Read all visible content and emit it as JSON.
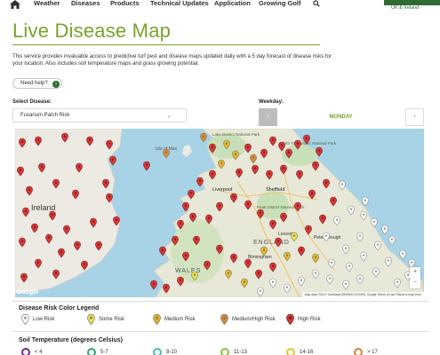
{
  "nav": {
    "items": [
      "Weather",
      "Diseases",
      "Products",
      "Technical Updates",
      "Application",
      "Growing Golf"
    ],
    "brand_sub": "UK & Ireland"
  },
  "page": {
    "title": "Live Disease Map",
    "intro": "This service provides invaluable access to predictive turf pest and disease maps updated daily with a 5 day forecast of disease risks for your location. Also includes soil temperature maps and grass growing potential.",
    "help_label": "Need help?"
  },
  "controls": {
    "disease_label": "Select Disease:",
    "disease_value": "Fusarium Patch Risk",
    "weekday_label": "Weekday:",
    "weekday_value": "MONDAY"
  },
  "map": {
    "places": [
      "Isle of Man",
      "Lake District National Park",
      "North York Moors National Park",
      "Ireland",
      "Liverpool",
      "Sheffield",
      "Peak District National Park",
      "Leicester",
      "Peterborough",
      "ENGLAND",
      "WALES",
      "Birmingham"
    ],
    "zoom_in": "+",
    "zoom_out": "−",
    "google": "Google",
    "credits": "Map data ©2017 GeoBasis-DE/BKG (©2009), Google   Terms of Use   Report a map error"
  },
  "legend": {
    "title": "Disease Risk Color Legend",
    "items": [
      {
        "label": "Low Risk",
        "color": "#ffffff"
      },
      {
        "label": "Some Risk",
        "color": "#f2e34a"
      },
      {
        "label": "Medium Risk",
        "color": "#e8b81e"
      },
      {
        "label": "Medium/High Risk",
        "color": "#e08a2a"
      },
      {
        "label": "High Risk",
        "color": "#d9383a"
      }
    ]
  },
  "soil": {
    "title": "Soil Temperature (degrees Celsius)",
    "items": [
      {
        "label": "< 4",
        "color": "#6a2a8a"
      },
      {
        "label": "5-7",
        "color": "#3aa37a"
      },
      {
        "label": "8-10",
        "color": "#4ac0b0"
      },
      {
        "label": "11-13",
        "color": "#8bc34a"
      },
      {
        "label": "14-16",
        "color": "#e8c430"
      },
      {
        "label": "> 17",
        "color": "#d9803a"
      }
    ]
  }
}
